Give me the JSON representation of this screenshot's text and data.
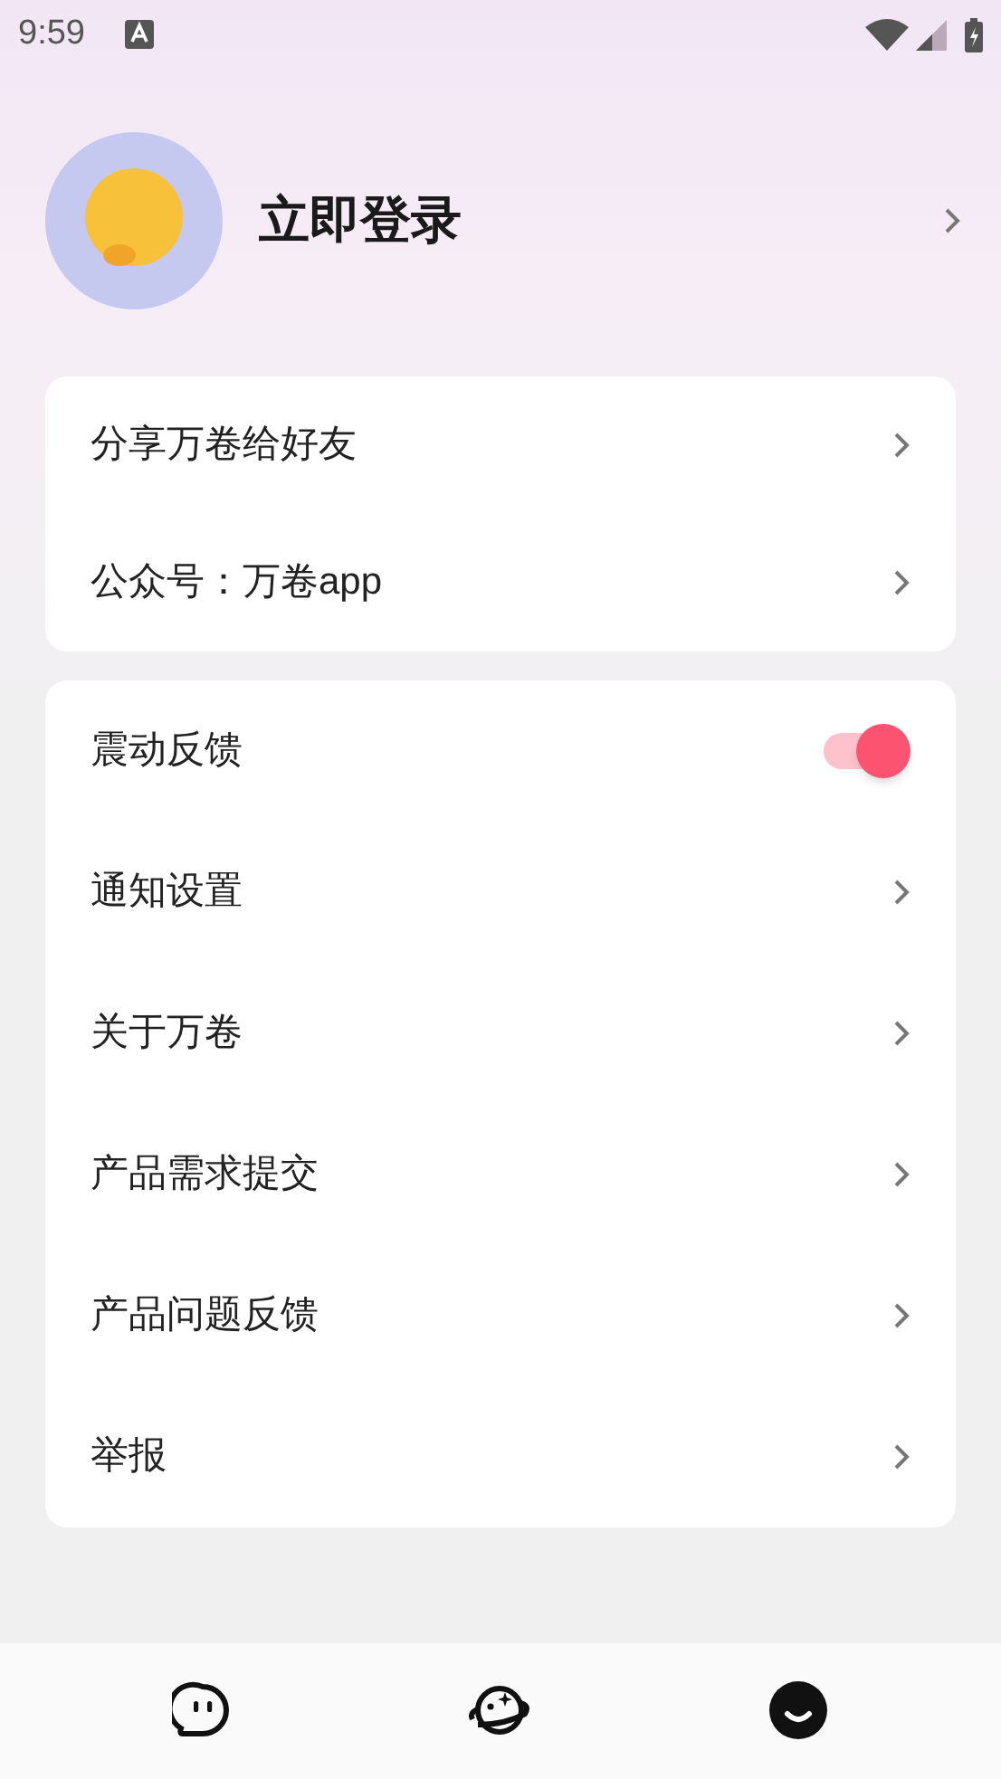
{
  "status_bar": {
    "time": "9:59"
  },
  "profile": {
    "title": "立即登录"
  },
  "groups": [
    {
      "items": [
        {
          "kind": "link",
          "label": "分享万卷给好友"
        },
        {
          "kind": "link",
          "label": "公众号：万卷app"
        }
      ]
    },
    {
      "items": [
        {
          "kind": "toggle",
          "label": "震动反馈",
          "on": true
        },
        {
          "kind": "link",
          "label": "通知设置"
        },
        {
          "kind": "link",
          "label": "关于万卷"
        },
        {
          "kind": "link",
          "label": "产品需求提交"
        },
        {
          "kind": "link",
          "label": "产品问题反馈"
        },
        {
          "kind": "link",
          "label": "举报"
        }
      ]
    }
  ],
  "bottom_nav": [
    {
      "kind": "chat",
      "selected": false
    },
    {
      "kind": "planet",
      "selected": false
    },
    {
      "kind": "me",
      "selected": true
    }
  ]
}
